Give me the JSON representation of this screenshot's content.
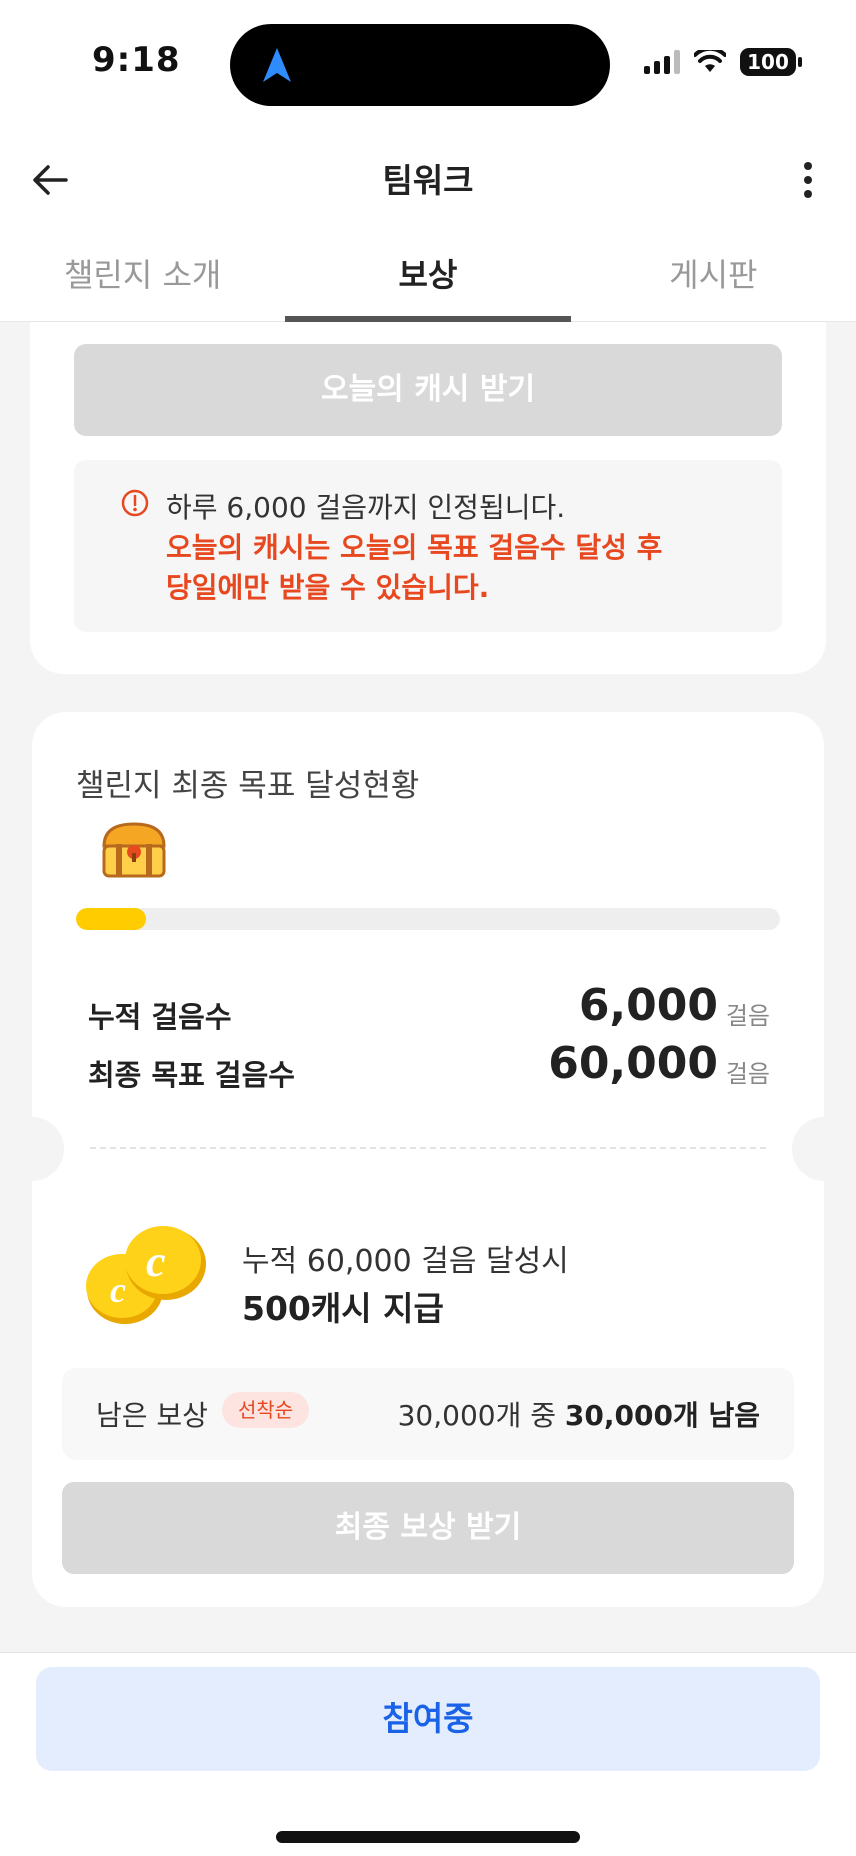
{
  "status_bar": {
    "time": "9:18",
    "battery": "100",
    "icons": [
      "location-arrow-icon",
      "signal-icon",
      "wifi-icon",
      "battery-icon"
    ]
  },
  "header": {
    "title": "팀워크",
    "back_icon": "arrow-left-icon",
    "more_icon": "more-vertical-icon"
  },
  "tabs": [
    {
      "label": "챌린지 소개",
      "active": false
    },
    {
      "label": "보상",
      "active": true
    },
    {
      "label": "게시판",
      "active": false
    }
  ],
  "today_card": {
    "button_label": "오늘의 캐시 받기",
    "notice_line1": "하루 6,000 걸음까지 인정됩니다.",
    "notice_line2": "오늘의 캐시는 오늘의 목표 걸음수 달성 후",
    "notice_line3": "당일에만 받을 수 있습니다.",
    "notice_icon": "alert-circle-icon"
  },
  "goal_card": {
    "title": "챌린지 최종 목표 달성현황",
    "chest_icon": "treasure-chest-icon",
    "progress": 0.1,
    "accumulated_label": "누적 걸음수",
    "accumulated_value": "6,000",
    "target_label": "최종 목표 걸음수",
    "target_value": "60,000",
    "unit": "걸음",
    "reward_icon": "coins-icon",
    "reward_condition": "누적 60,000 걸음 달성시",
    "reward_amount": "500캐시 지급",
    "remaining_label": "남은 보상",
    "remaining_badge": "선착순",
    "remaining_prefix": "30,000개 중",
    "remaining_count": "30,000개 남음",
    "final_button_label": "최종 보상 받기"
  },
  "bottom": {
    "join_label": "참여중"
  },
  "colors": {
    "accent_blue": "#1a62e6",
    "warning_red": "#e8481f",
    "progress_yellow": "#ffcc00",
    "disabled_gray": "#d9d9d9"
  }
}
